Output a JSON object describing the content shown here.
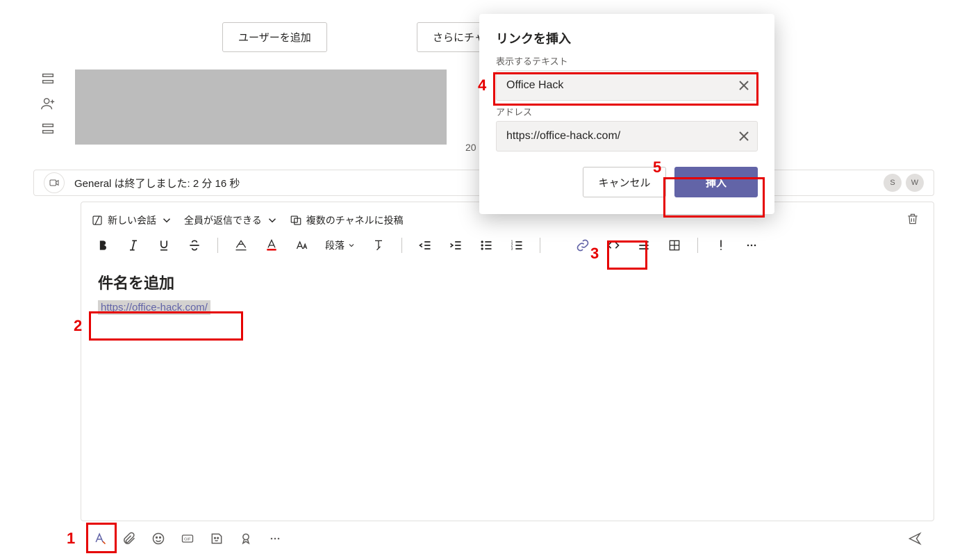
{
  "topButtons": {
    "addUser": "ユーザーを追加",
    "moreChannels": "さらにチャ"
  },
  "truncatedNumber": "20",
  "meetingRow": {
    "text": "General は終了しました: 2 分 16 秒",
    "badges": [
      "S",
      "W"
    ]
  },
  "composer": {
    "newConversation": "新しい会話",
    "replyAll": "全員が返信できる",
    "multiPost": "複数のチャネルに投稿",
    "paragraphLabel": "段落",
    "subjectPlaceholder": "件名を追加",
    "bodyLinkText": "https://office-hack.com/"
  },
  "dialog": {
    "title": "リンクを挿入",
    "displayLabel": "表示するテキスト",
    "displayValue": "Office Hack",
    "addressLabel": "アドレス",
    "addressValue": "https://office-hack.com/",
    "cancel": "キャンセル",
    "insert": "挿入"
  },
  "annotations": {
    "1": "1",
    "2": "2",
    "3": "3",
    "4": "4",
    "5": "5"
  }
}
